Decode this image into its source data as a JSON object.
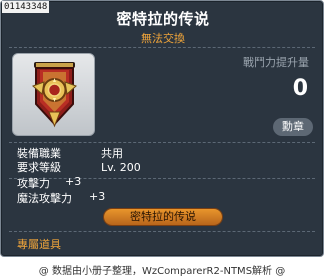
{
  "item": {
    "code": "01143348",
    "title": "密特拉的传说",
    "trade_status": "無法交換"
  },
  "power": {
    "label": "戰鬥力提升量",
    "value": "0"
  },
  "badge_button": "勳章",
  "requirements": [
    {
      "label": "裝備職業",
      "value": "共用"
    },
    {
      "label": "要求等級",
      "value": "Lv. 200"
    }
  ],
  "stats": [
    {
      "label": "攻擊力",
      "value": "+3"
    },
    {
      "label": "魔法攻擊力",
      "value": "+3"
    }
  ],
  "set_item": "密特拉的传说",
  "exclusive": "專屬道具",
  "footer": "@ 数据由小册子整理，WzComparerR2-NTMS解析 @",
  "colors": {
    "background": "#2b3540",
    "accent_orange": "#f0a53a",
    "label_gray": "#9aa4ae"
  },
  "icon": "medal-icon"
}
